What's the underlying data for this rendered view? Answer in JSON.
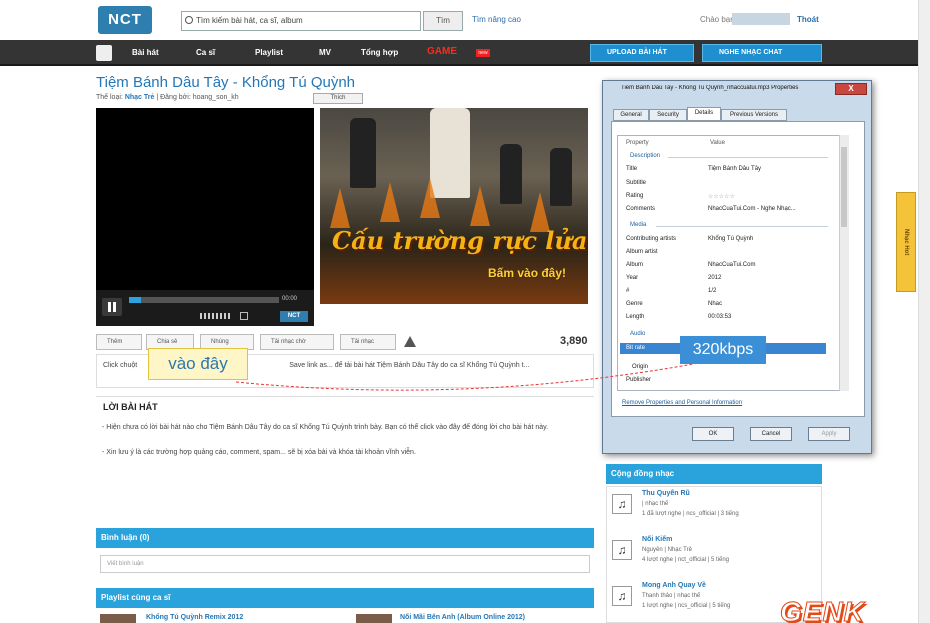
{
  "header": {
    "logo_text": "NCT",
    "search_placeholder": "Tìm kiếm bài hát, ca sĩ, album",
    "search_button": "Tìm",
    "advanced_link": "Tìm nâng cao",
    "greeting": "Chào bạn",
    "logout_label": "Thoát"
  },
  "nav": {
    "items": [
      "Bài hát",
      "Ca sĩ",
      "Playlist",
      "MV",
      "Tổng hợp"
    ],
    "game_label": "GAME",
    "game_badge": "new",
    "upload_label": "UPLOAD BÀI HÁT",
    "nghe_label": "NGHE NHẠC CHAT"
  },
  "song": {
    "title": "Tiệm Bánh Dâu Tây - Khổng Tú Quỳnh",
    "meta_prefix": "Thể loại:",
    "genre": "Nhạc Trẻ",
    "meta_suffix": "| Đăng bởi: hoang_son_kh",
    "like_label": "Thích",
    "progress": 0.08,
    "time": "00:00"
  },
  "ad": {
    "headline": "Cấu trường rực lửa",
    "cta": "Bấm vào đây!"
  },
  "actions": {
    "buttons": [
      "Thêm",
      "Chia sẻ",
      "Nhúng",
      "Tải nhạc chờ",
      "Tải nhạc"
    ],
    "play_count": "3,890"
  },
  "download_tip": {
    "text_before": "Click chuột",
    "text_after": "Save link as... để tải bài hát Tiệm Bánh Dâu Tây do ca sĩ Khổng Tú Quỳnh t..."
  },
  "callouts": {
    "here": "vào đây",
    "bitrate": "320kbps"
  },
  "lyrics": {
    "title": "LỜI BÀI HÁT",
    "line1": "- Hiện chưa có lời bài hát nào cho Tiệm Bánh Dâu Tây do ca sĩ Khổng Tú Quỳnh trình bày. Bạn có thể click vào đây để đóng lời cho bài hát này.",
    "line2": "- Xin lưu ý là các trường hợp quảng cáo, comment, spam... sẽ bị xóa bài và khóa tài khoản vĩnh viễn."
  },
  "comments": {
    "header": "Bình luận (0)",
    "placeholder": "Viết bình luận"
  },
  "playlist": {
    "header": "Playlist cùng ca sĩ",
    "items": [
      "Khổng Tú Quỳnh Remix 2012",
      "Nối Mãi Bên Anh (Album Online 2012)"
    ]
  },
  "community": {
    "header": "Cộng đồng nhạc",
    "items": [
      {
        "title": "Thu Quyến Rũ",
        "sub": "| nhạc thế",
        "stats": "1 đã lượt nghe | ncs_official | 3 tiếng"
      },
      {
        "title": "Nối Kiếm",
        "sub": "Nguyên | Nhạc Trẻ",
        "stats": "4 lượt nghe | nct_official | 5 tiếng"
      },
      {
        "title": "Mong Anh Quay Về",
        "sub": "Thanh thảo | nhạc thế",
        "stats": "1 lượt nghe | ncs_official | 5 tiếng"
      }
    ]
  },
  "dialog": {
    "title": "Tiem Banh Dau Tay - Khong Tu Quynh_nhaccuatui.mp3 Properties",
    "close": "X",
    "tabs": [
      "General",
      "Security",
      "Details",
      "Previous Versions"
    ],
    "col_property": "Property",
    "col_value": "Value",
    "sections": [
      "Description",
      "Media",
      "Audio"
    ],
    "rows": [
      {
        "p": "Title",
        "v": "Tiệm Bánh Dâu Tây"
      },
      {
        "p": "Subtitle",
        "v": ""
      },
      {
        "p": "Rating",
        "v": "☆☆☆☆☆"
      },
      {
        "p": "Comments",
        "v": "NhacCuaTui.Com - Nghe Nhạc..."
      },
      {
        "p": "Contributing artists",
        "v": "Khổng Tú Quỳnh"
      },
      {
        "p": "Album artist",
        "v": ""
      },
      {
        "p": "Album",
        "v": "NhacCuaTui.Com"
      },
      {
        "p": "Year",
        "v": "2012"
      },
      {
        "p": "#",
        "v": "1/2"
      },
      {
        "p": "Genre",
        "v": "Nhac"
      },
      {
        "p": "Length",
        "v": "00:03:53"
      }
    ],
    "bitrate_label": "Bit rate",
    "after_rows": [
      "Origin",
      "Publisher"
    ],
    "link": "Remove Properties and Personal Information",
    "ok": "OK",
    "cancel": "Cancel",
    "apply": "Apply"
  },
  "ribbon_text": "Nhạc Hot",
  "watermark": "GENK"
}
